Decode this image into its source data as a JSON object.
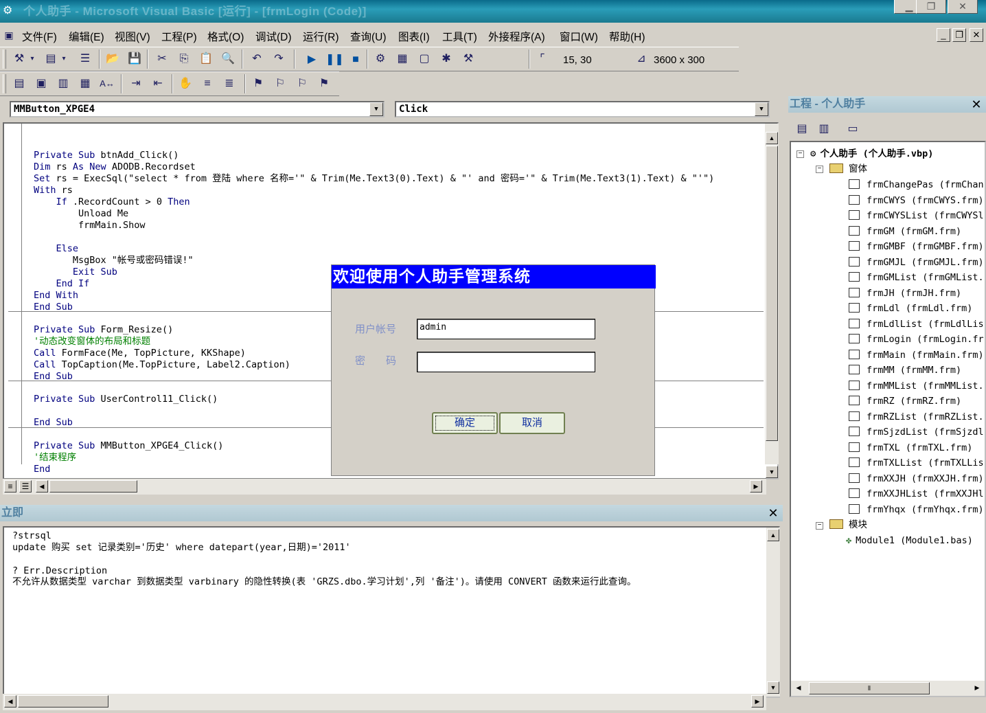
{
  "window": {
    "title": "个人助手 - Microsoft Visual Basic [运行] - [frmLogin (Code)]",
    "minimize": "▁",
    "restore": "❐",
    "close": "✕"
  },
  "menu": [
    "文件(F)",
    "编辑(E)",
    "视图(V)",
    "工程(P)",
    "格式(O)",
    "调试(D)",
    "运行(R)",
    "查询(U)",
    "图表(I)",
    "工具(T)",
    "外接程序(A)",
    "窗口(W)",
    "帮助(H)"
  ],
  "mdi_controls": {
    "min": "_",
    "restore": "❐",
    "close": "✕"
  },
  "toolbar": {
    "position": "15, 30",
    "size": "3600 x 300"
  },
  "code_window": {
    "object_combo": "MMButton_XPGE4",
    "proc_combo": "Click",
    "lines": [
      "Private Sub btnAdd_Click()",
      "Dim rs As New ADODB.Recordset",
      "Set rs = ExecSql(\"select * from 登陆 where 名称='\" & Trim(Me.Text3(0).Text) & \"' and 密码='\" & Trim(Me.Text3(1).Text) & \"'\")",
      "With rs",
      "    If .RecordCount > 0 Then",
      "        Unload Me",
      "        frmMain.Show",
      "",
      "    Else",
      "       MsgBox \"帐号或密码错误!\"",
      "       Exit Sub",
      "    End If",
      "End With",
      "End Sub",
      "Private Sub Form_Resize()",
      "'动态改变窗体的布局和标题",
      "Call FormFace(Me, TopPicture, KKShape)",
      "Call TopCaption(Me.TopPicture, Label2.Caption)",
      "End Sub",
      "Private Sub UserControl11_Click()",
      "",
      "End Sub",
      "Private Sub MMButton_XPGE4_Click()",
      "'结束程序",
      "End"
    ]
  },
  "immediate": {
    "title": "立即",
    "lines": [
      "?strsql",
      "update 购买 set 记录类别='历史' where datepart(year,日期)='2011'",
      "",
      "? Err.Description",
      "不允许从数据类型 varchar 到数据类型 varbinary 的隐性转换(表 'GRZS.dbo.学习计划',列 '备注')。请使用 CONVERT 函数来运行此查询。"
    ]
  },
  "project": {
    "title": "工程 - 个人助手",
    "root": "个人助手 (个人助手.vbp)",
    "forms_folder": "窗体",
    "forms": [
      "frmChangePas (frmChan",
      "frmCWYS (frmCWYS.frm)",
      "frmCWYSList (frmCWYSl",
      "frmGM (frmGM.frm)",
      "frmGMBF (frmGMBF.frm)",
      "frmGMJL (frmGMJL.frm)",
      "frmGMList (frmGMList.",
      "frmJH (frmJH.frm)",
      "frmLdl (frmLdl.frm)",
      "frmLdlList (frmLdlLis",
      "frmLogin (frmLogin.fr",
      "frmMain (frmMain.frm)",
      "frmMM (frmMM.frm)",
      "frmMMList (frmMMList.",
      "frmRZ (frmRZ.frm)",
      "frmRZList (frmRZList.",
      "frmSjzdList (frmSjzdl",
      "frmTXL (frmTXL.frm)",
      "frmTXLList (frmTXLLis",
      "frmXXJH (frmXXJH.frm)",
      "frmXXJHList (frmXXJHl",
      "frmYhqx (frmYhqx.frm)"
    ],
    "modules_folder": "模块",
    "modules": [
      "Module1 (Module1.bas)"
    ]
  },
  "dialog": {
    "title": "欢迎使用个人助手管理系统",
    "user_label": "用户帐号",
    "user_value": "admin",
    "pwd_label": "密　　码",
    "pwd_value": "",
    "ok": "确定",
    "cancel": "取消"
  }
}
